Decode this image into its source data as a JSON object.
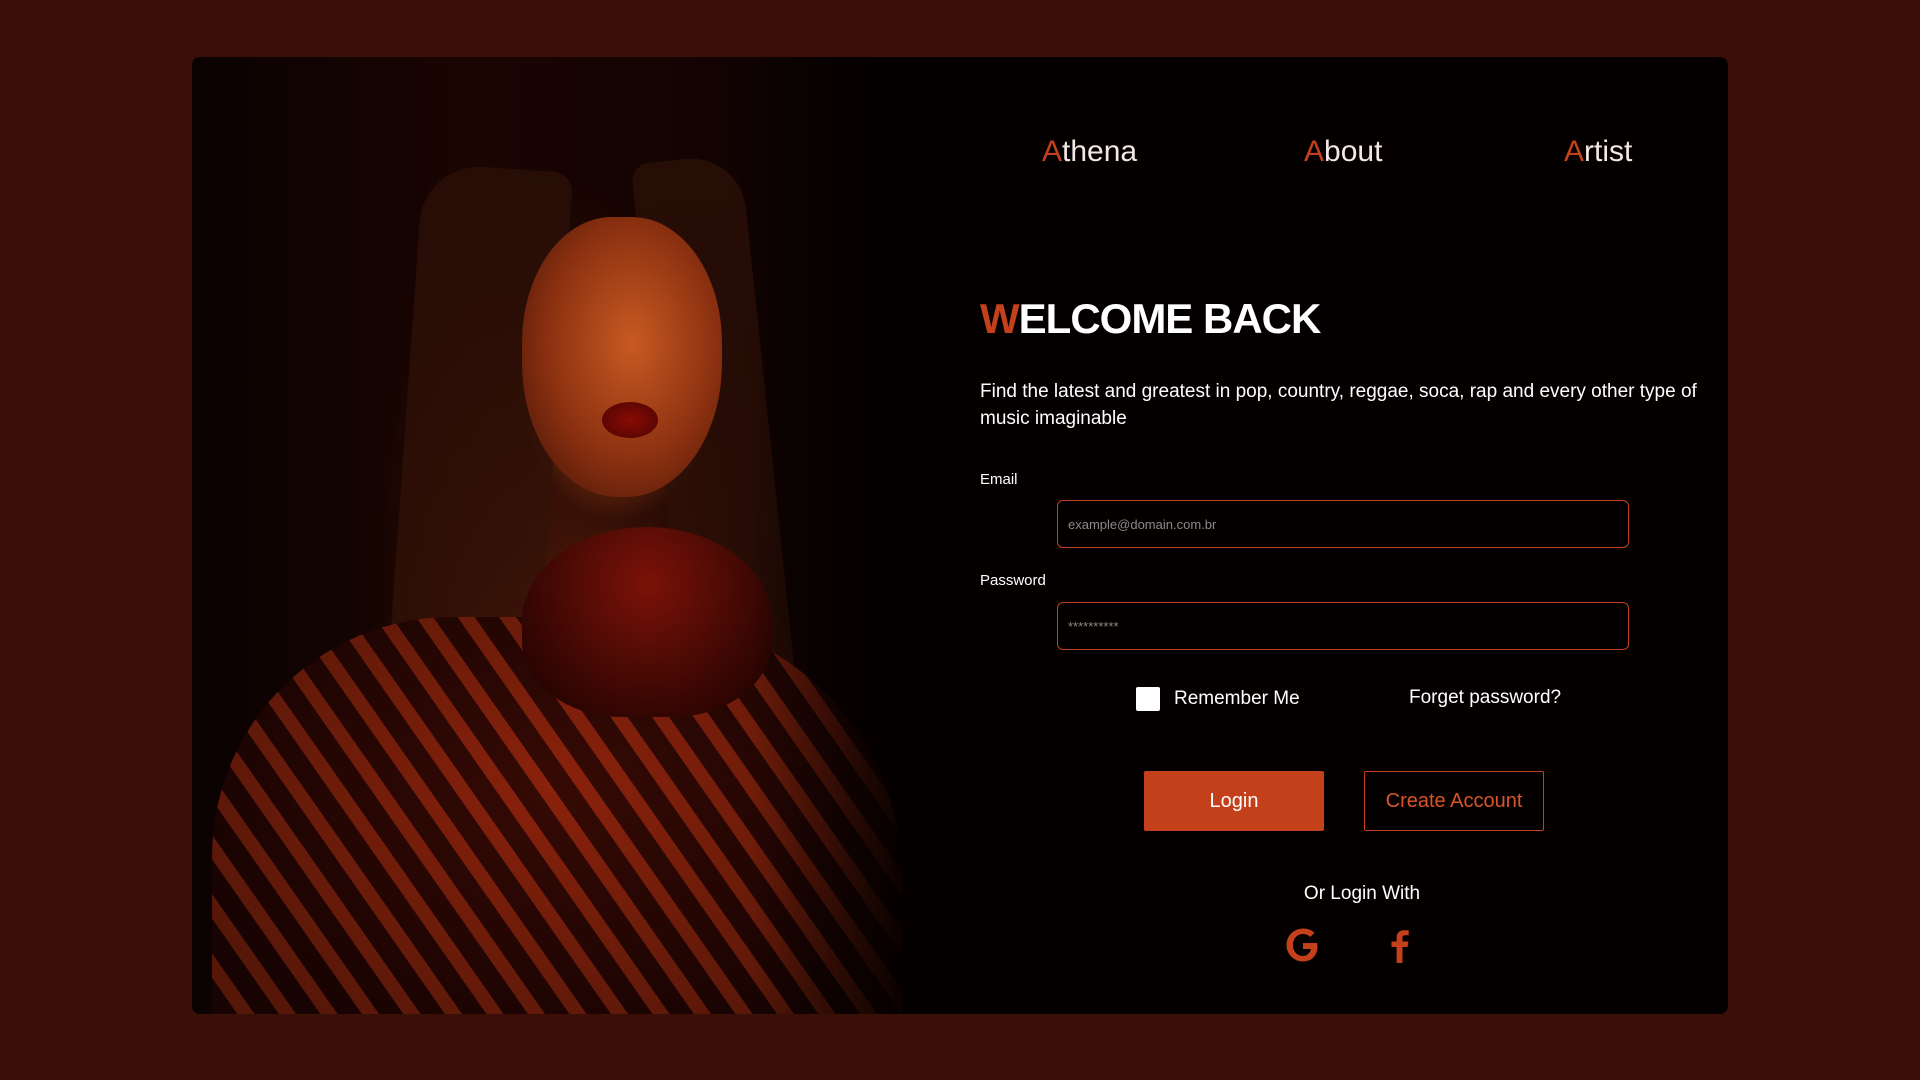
{
  "nav": {
    "items": [
      {
        "first": "A",
        "rest": "thena"
      },
      {
        "first": "A",
        "rest": "bout"
      },
      {
        "first": "A",
        "rest": "rtist"
      }
    ]
  },
  "hero": {
    "title_first": "W",
    "title_rest": "ELCOME BACK",
    "subtitle": "Find the latest and greatest in pop, country, reggae, soca, rap and every other type of music imaginable"
  },
  "form": {
    "email_label": "Email",
    "email_placeholder": "example@domain.com.br",
    "email_value": "",
    "password_label": "Password",
    "password_placeholder": "**********",
    "password_value": "",
    "remember_label": "Remember Me",
    "forget_label": "Forget password?",
    "login_label": "Login",
    "create_label": "Create Account",
    "or_login_label": "Or Login With"
  },
  "social": {
    "google_icon": "google-icon",
    "facebook_icon": "facebook-icon"
  },
  "colors": {
    "accent": "#c4401a",
    "background": "#3a0f08",
    "card": "#050000",
    "text": "#ffffff"
  }
}
